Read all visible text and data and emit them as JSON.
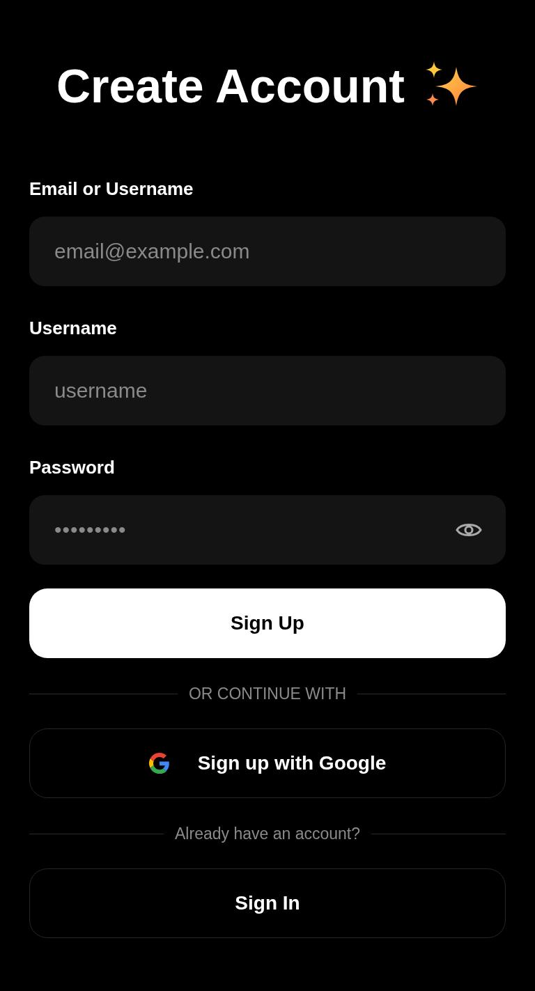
{
  "title": "Create Account",
  "fields": [
    {
      "kind": "text",
      "label": "Email or Username",
      "placeholder": "email@example.com"
    },
    {
      "kind": "text",
      "label": "Username",
      "placeholder": "username"
    },
    {
      "kind": "password",
      "label": "Password",
      "placeholder": "•••••••••"
    }
  ],
  "submit": "Sign Up",
  "divider_1": "OR CONTINUE WITH",
  "google_button": "Sign up with Google",
  "divider_2": "Already have an account?",
  "sign_in": "Sign In"
}
